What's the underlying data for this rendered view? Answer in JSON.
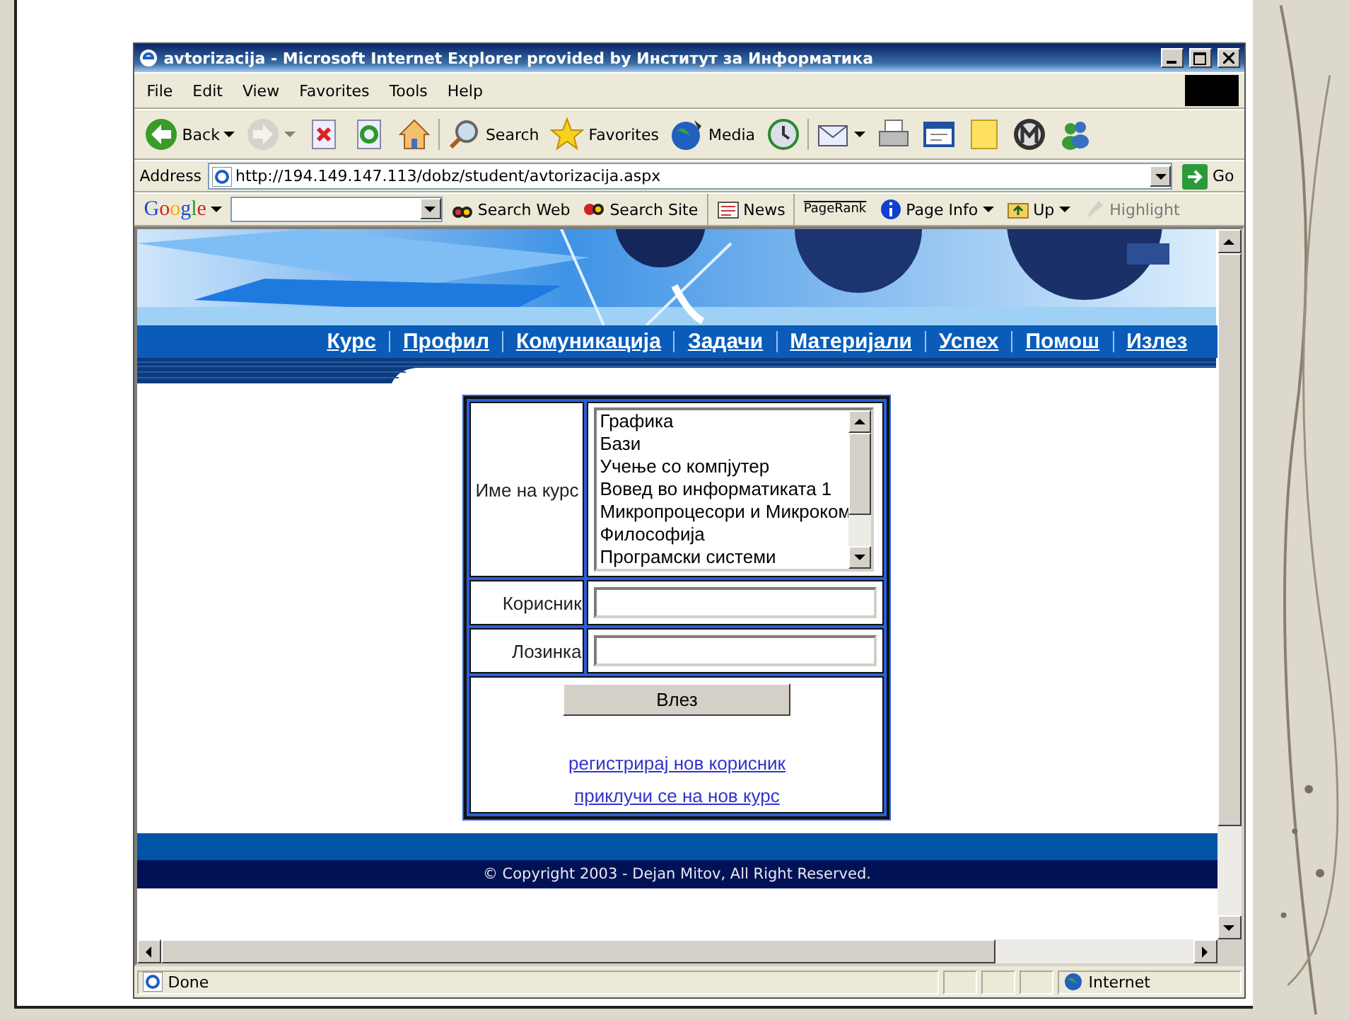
{
  "window": {
    "title": "avtorizacija - Microsoft Internet Explorer provided by Институт за Информатика"
  },
  "menu": [
    "File",
    "Edit",
    "View",
    "Favorites",
    "Tools",
    "Help"
  ],
  "toolbar": [
    {
      "kind": "back",
      "label": "Back",
      "disabled": false,
      "dropdown": true
    },
    {
      "kind": "forward",
      "disabled": true,
      "dropdown": true
    },
    {
      "kind": "stop",
      "disabled": false
    },
    {
      "kind": "refresh",
      "disabled": false
    },
    {
      "kind": "home",
      "disabled": false
    },
    {
      "kind": "search",
      "label": "Search",
      "disabled": false
    },
    {
      "kind": "favorites",
      "label": "Favorites",
      "disabled": false
    },
    {
      "kind": "media",
      "label": "Media",
      "disabled": false
    },
    {
      "kind": "history",
      "disabled": false
    },
    {
      "kind": "mail",
      "disabled": false,
      "dropdown": true
    },
    {
      "kind": "print",
      "disabled": false
    },
    {
      "kind": "edit",
      "disabled": false
    },
    {
      "kind": "note",
      "disabled": false
    },
    {
      "kind": "messenger",
      "disabled": false
    },
    {
      "kind": "people",
      "disabled": false
    }
  ],
  "address": {
    "label": "Address",
    "url": "http://194.149.147.113/dobz/student/avtorizacija.aspx",
    "go": "Go"
  },
  "google_bar": {
    "logo": "Google",
    "items": [
      {
        "kind": "search-web",
        "label": "Search Web",
        "disabled": false
      },
      {
        "kind": "search-site",
        "label": "Search Site",
        "disabled": false
      },
      {
        "kind": "news",
        "label": "News",
        "disabled": false
      },
      {
        "kind": "pagerank",
        "label": "PageRank",
        "disabled": false
      },
      {
        "kind": "info",
        "label": "Page Info",
        "disabled": false,
        "dropdown": true
      },
      {
        "kind": "up",
        "label": "Up",
        "disabled": false,
        "dropdown": true
      },
      {
        "kind": "highlight",
        "label": "Highlight",
        "disabled": true
      }
    ]
  },
  "nav": [
    "Курс",
    "Профил",
    "Комуникација",
    "Задачи",
    "Материјали",
    "Успех",
    "Помош",
    "Излез"
  ],
  "form": {
    "course_label": "Име на курс",
    "courses": [
      "Графика",
      "Бази",
      "Учење со компјутер",
      "Вовед во информатиката 1",
      "Микропроцесори и Микроком",
      "Философија",
      "Програмски системи"
    ],
    "user_label": "Корисник",
    "password_label": "Лозинка",
    "submit": "Влез",
    "links": [
      "регистрирај нов корисник",
      "приклучи се на нов курс"
    ]
  },
  "footer": {
    "copyright": "© Copyright 2003 - Dejan Mitov, All Right Reserved."
  },
  "status_bar": {
    "text": "Done",
    "zone": "Internet"
  }
}
